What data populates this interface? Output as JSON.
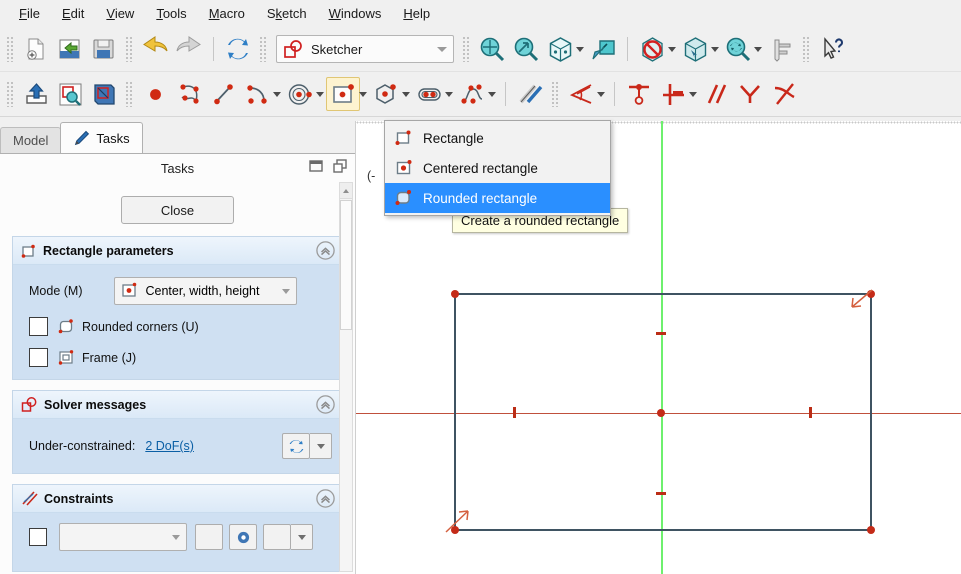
{
  "app": {
    "workbench": "Sketcher"
  },
  "menubar": {
    "items": [
      {
        "name": "file",
        "label": "File",
        "mnemonic": "F"
      },
      {
        "name": "edit",
        "label": "Edit",
        "mnemonic": "E"
      },
      {
        "name": "view",
        "label": "View",
        "mnemonic": "V"
      },
      {
        "name": "tools",
        "label": "Tools",
        "mnemonic": "T"
      },
      {
        "name": "macro",
        "label": "Macro",
        "mnemonic": "M"
      },
      {
        "name": "sketch",
        "label": "Sketch",
        "mnemonic": "k"
      },
      {
        "name": "windows",
        "label": "Windows",
        "mnemonic": "W"
      },
      {
        "name": "help",
        "label": "Help",
        "mnemonic": "H"
      }
    ]
  },
  "toolbar_file": {
    "buttons": [
      {
        "name": "new-document-button",
        "icon": "new-document-icon"
      },
      {
        "name": "open-document-button",
        "icon": "open-folder-icon"
      },
      {
        "name": "save-document-button",
        "icon": "floppy-save-icon"
      },
      {
        "name": "undo-button",
        "icon": "undo-arrow-icon"
      },
      {
        "name": "redo-button",
        "icon": "redo-arrow-icon"
      },
      {
        "name": "refresh-button",
        "icon": "refresh-icon"
      }
    ]
  },
  "toolbar_view": {
    "buttons": [
      {
        "name": "fit-all-button",
        "icon": "fit-all-magnifier-icon"
      },
      {
        "name": "zoom-selection-button",
        "icon": "zoom-arrow-magnifier-icon"
      },
      {
        "name": "axonometric-button",
        "icon": "iso-cube-icon"
      },
      {
        "name": "draw-style-button",
        "icon": "draw-style-icon"
      },
      {
        "name": "clipping-button",
        "icon": "no-entry-icon"
      },
      {
        "name": "section-view-button",
        "icon": "cube-selection-icon"
      },
      {
        "name": "sync-view-button",
        "icon": "refresh-magnifier-icon"
      },
      {
        "name": "measure-button",
        "icon": "caliper-icon"
      },
      {
        "name": "whats-this-button",
        "icon": "cursor-question-icon"
      }
    ]
  },
  "toolbar_sketcher": {
    "buttons": [
      {
        "name": "leave-sketch-button",
        "icon": "leave-sketch-icon"
      },
      {
        "name": "view-sketch-button",
        "icon": "view-sketch-icon"
      },
      {
        "name": "view-section-button",
        "icon": "view-section-icon"
      },
      {
        "name": "create-point-button",
        "icon": "point-icon"
      },
      {
        "name": "create-polyline-button",
        "icon": "polyline-icon"
      },
      {
        "name": "create-line-button",
        "icon": "line-icon"
      },
      {
        "name": "create-arc-button",
        "icon": "arc-icon"
      },
      {
        "name": "create-circle-button",
        "icon": "circle-icon"
      },
      {
        "name": "create-rectangle-button",
        "icon": "rectangle-icon"
      },
      {
        "name": "create-polygon-button",
        "icon": "hexagon-icon"
      },
      {
        "name": "create-slot-button",
        "icon": "slot-icon"
      },
      {
        "name": "create-bspline-button",
        "icon": "bspline-icon"
      },
      {
        "name": "toggle-construction-button",
        "icon": "construction-lines-icon"
      },
      {
        "name": "dimension-button",
        "icon": "dimension-angle-icon"
      },
      {
        "name": "constrain-coincident-button",
        "icon": "coincident-constraint-icon"
      },
      {
        "name": "constrain-horizontal-button",
        "icon": "horizontal-vertical-constraint-icon"
      },
      {
        "name": "constrain-parallel-button",
        "icon": "parallel-constraint-icon"
      },
      {
        "name": "constrain-perpendicular-button",
        "icon": "perpendicular-constraint-icon"
      },
      {
        "name": "constrain-tangent-button",
        "icon": "tangent-constraint-icon"
      }
    ]
  },
  "panel": {
    "tabs": [
      {
        "name": "tab-model",
        "label": "Model",
        "active": false
      },
      {
        "name": "tab-tasks",
        "label": "Tasks",
        "active": true
      }
    ],
    "title": "Tasks",
    "close_label": "Close",
    "rectangle_parameters": {
      "title": "Rectangle parameters",
      "mode_label": "Mode (M)",
      "mode_value": "Center, width, height",
      "checkbox_rounded": "Rounded corners (U)",
      "checkbox_frame": "Frame (J)",
      "rounded_checked": false,
      "frame_checked": false
    },
    "solver_messages": {
      "title": "Solver messages",
      "status_label": "Under-constrained:",
      "dof_link": "2 DoF(s)"
    },
    "constraints": {
      "title": "Constraints"
    }
  },
  "dropdown_menu": {
    "items": [
      {
        "name": "menu-item-rectangle",
        "label": "Rectangle",
        "icon": "rectangle-icon",
        "selected": false
      },
      {
        "name": "menu-item-centered-rectangle",
        "label": "Centered rectangle",
        "icon": "centered-rectangle-icon",
        "selected": false
      },
      {
        "name": "menu-item-rounded-rectangle",
        "label": "Rounded rectangle",
        "icon": "rounded-rectangle-icon",
        "selected": true
      }
    ],
    "tooltip": "Create a rounded rectangle"
  },
  "viewport": {
    "clipped_label": "(-",
    "colors": {
      "edge": "#3f5362",
      "vertex": "#c42b18",
      "x_axis": "#c0503c",
      "y_axis": "#6ef06e",
      "background": "#ffffff"
    }
  }
}
